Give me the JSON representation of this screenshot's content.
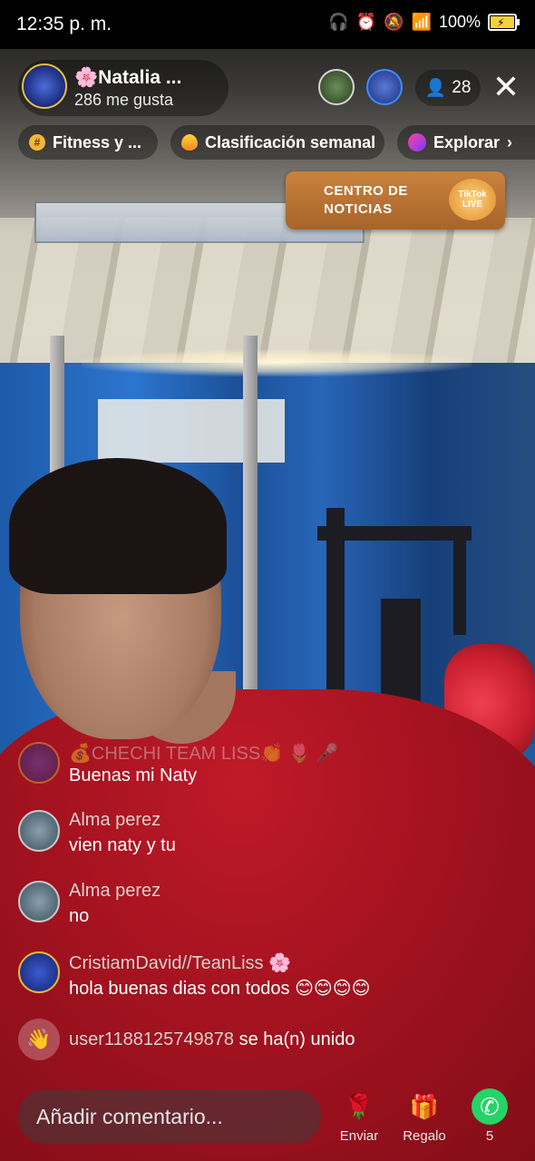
{
  "status_bar": {
    "time": "12:35 p. m.",
    "battery": "100%"
  },
  "host": {
    "name": "🌸Natalia ...",
    "likes": "286 me gusta"
  },
  "viewers": {
    "count": "28"
  },
  "chips": [
    {
      "label": "Fitness y ..."
    },
    {
      "label": "Clasificación semanal"
    },
    {
      "label": "Explorar"
    }
  ],
  "news": {
    "title": "CENTRO DE NOTICIAS",
    "badge": "TikTok LIVE"
  },
  "chat": [
    {
      "user": "💰CHECHI  TEAM  LISS👏 🌷 🎤",
      "text": "Buenas  mi Naty"
    },
    {
      "user": "Alma perez",
      "text": "vien naty y tu"
    },
    {
      "user": "Alma perez",
      "text": "no"
    },
    {
      "user": "CristiamDavid//TeanLiss 🌸",
      "text": "hola buenas dias con todos 😊😊😊😊"
    }
  ],
  "join_event": {
    "user": "user1188125749878",
    "action": " se ha(n) unido"
  },
  "bottom_bar": {
    "comment_placeholder": "Añadir comentario...",
    "send_label": "Enviar",
    "gift_label": "Regalo",
    "share_count": "5"
  },
  "icons": {
    "battery_color": "#f4d23c",
    "whatsapp_color": "#25d366"
  }
}
